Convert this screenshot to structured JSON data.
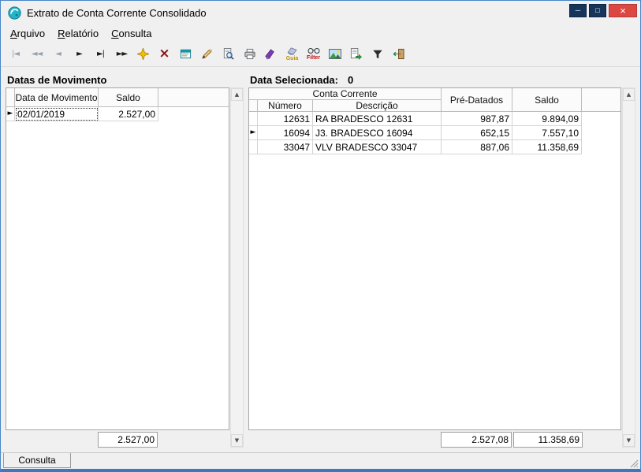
{
  "window": {
    "title": "Extrato de Conta Corrente Consolidado",
    "controls": {
      "minimize": "─",
      "maximize": "□",
      "close": "×"
    }
  },
  "icons": {
    "row_indicator": "►",
    "scroll_up": "▲",
    "scroll_down": "▼"
  },
  "menu": {
    "items": [
      {
        "accel": "A",
        "rest": "rquivo"
      },
      {
        "accel": "R",
        "rest": "elatório"
      },
      {
        "accel": "C",
        "rest": "onsulta"
      }
    ]
  },
  "toolbar": {
    "buttons": [
      {
        "name": "first-record",
        "glyph": "|◄"
      },
      {
        "name": "prior-page",
        "glyph": "◄◄"
      },
      {
        "name": "prior-record",
        "glyph": "◄"
      },
      {
        "name": "next-record",
        "glyph": "►"
      },
      {
        "name": "last-record",
        "glyph": "►|"
      },
      {
        "name": "next-page",
        "glyph": "►►"
      },
      {
        "name": "insert-record"
      },
      {
        "name": "delete-record",
        "glyph": "×"
      },
      {
        "name": "edit-record"
      },
      {
        "name": "execute-search"
      },
      {
        "name": "print-preview"
      },
      {
        "name": "print"
      },
      {
        "name": "clear"
      },
      {
        "name": "guia",
        "caption": "Guia"
      },
      {
        "name": "filter-glasses",
        "caption": "Filter"
      },
      {
        "name": "picture"
      },
      {
        "name": "export"
      },
      {
        "name": "filter-funnel"
      },
      {
        "name": "exit"
      }
    ]
  },
  "left_panel": {
    "title": "Datas de Movimento",
    "columns": {
      "date": "Data de Movimento",
      "saldo": "Saldo"
    },
    "rows": [
      {
        "date": "02/01/2019",
        "saldo": "2.527,00"
      }
    ],
    "footer": {
      "saldo": "2.527,00"
    }
  },
  "right_panel": {
    "title": "Data Selecionada:",
    "count": "0",
    "group_header": "Conta Corrente",
    "columns": {
      "numero": "Número",
      "descricao": "Descrição",
      "pre_datados": "Pré-Datados",
      "saldo": "Saldo"
    },
    "rows": [
      {
        "numero": "12631",
        "descricao": "RA BRADESCO 12631",
        "pre_datados": "987,87",
        "saldo": "9.894,09"
      },
      {
        "numero": "16094",
        "descricao": "J3. BRADESCO 16094",
        "pre_datados": "652,15",
        "saldo": "7.557,10"
      },
      {
        "numero": "33047",
        "descricao": "VLV BRADESCO 33047",
        "pre_datados": "887,06",
        "saldo": "11.358,69"
      }
    ],
    "footer": {
      "pre_datados": "2.527,08",
      "saldo": "11.358,69"
    }
  },
  "statusbar": {
    "tab": "Consulta"
  }
}
